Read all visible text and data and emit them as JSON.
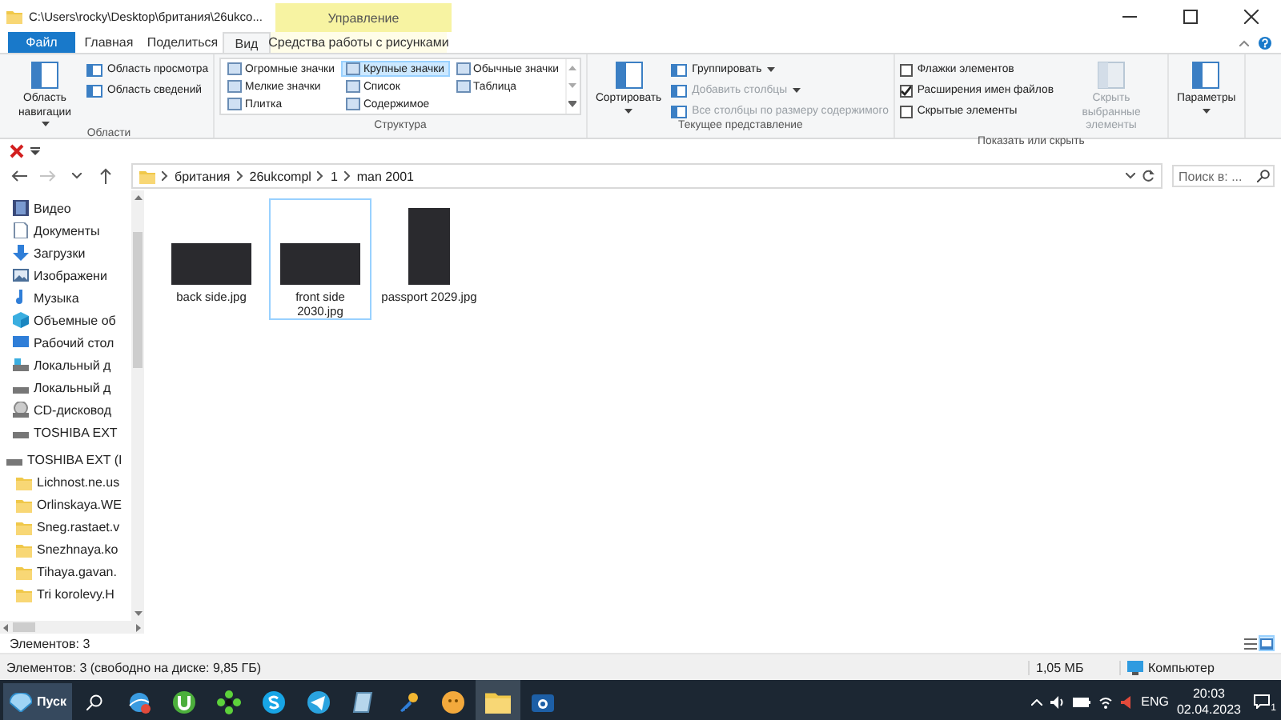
{
  "window": {
    "title": "C:\\Users\\rocky\\Desktop\\британия\\26ukco...",
    "context_header": "Управление"
  },
  "tabs": [
    {
      "label": "Файл",
      "kind": "file",
      "selected": false
    },
    {
      "label": "Главная",
      "kind": "tab",
      "selected": false
    },
    {
      "label": "Поделиться",
      "kind": "tab",
      "selected": false
    },
    {
      "label": "Вид",
      "kind": "tab",
      "selected": true
    },
    {
      "label": "Средства работы с рисунками",
      "kind": "context",
      "selected": false
    }
  ],
  "ribbon": {
    "groups": [
      {
        "label": "Области",
        "items": [
          {
            "kind": "large",
            "label": "Область навигации",
            "dropdown": true,
            "disabled": false
          },
          {
            "kind": "small",
            "label": "Область просмотра",
            "dropdown": false,
            "disabled": false
          },
          {
            "kind": "small",
            "label": "Область сведений",
            "dropdown": false,
            "disabled": false
          }
        ]
      },
      {
        "label": "Структура",
        "items": [
          {
            "kind": "gallery",
            "label": "Огромные значки",
            "selected": false
          },
          {
            "kind": "gallery",
            "label": "Крупные значки",
            "selected": true
          },
          {
            "kind": "gallery",
            "label": "Обычные значки",
            "selected": false
          },
          {
            "kind": "gallery",
            "label": "Мелкие значки",
            "selected": false
          },
          {
            "kind": "gallery",
            "label": "Список",
            "selected": false
          },
          {
            "kind": "gallery",
            "label": "Таблица",
            "selected": false
          },
          {
            "kind": "gallery",
            "label": "Плитка",
            "selected": false
          },
          {
            "kind": "gallery",
            "label": "Содержимое",
            "selected": false
          }
        ]
      },
      {
        "label": "Текущее представление",
        "items": [
          {
            "kind": "large",
            "label": "Сортировать",
            "dropdown": true,
            "disabled": false
          },
          {
            "kind": "small",
            "label": "Группировать",
            "dropdown": true,
            "disabled": false
          },
          {
            "kind": "small",
            "label": "Добавить столбцы",
            "dropdown": true,
            "disabled": true
          },
          {
            "kind": "small",
            "label": "Все столбцы по размеру содержимого",
            "dropdown": false,
            "disabled": true
          }
        ]
      },
      {
        "label": "Показать или скрыть",
        "items": [
          {
            "kind": "checkbox",
            "label": "Флажки элементов",
            "checked": false
          },
          {
            "kind": "checkbox",
            "label": "Расширения имен файлов",
            "checked": true
          },
          {
            "kind": "checkbox",
            "label": "Скрытые элементы",
            "checked": false
          },
          {
            "kind": "large",
            "label": "Скрыть выбранные элементы",
            "dropdown": false,
            "disabled": true
          }
        ]
      },
      {
        "items": [
          {
            "kind": "large",
            "label": "Параметры",
            "dropdown": true,
            "disabled": false
          }
        ]
      }
    ]
  },
  "nav_buttons": [
    {
      "kind": "back",
      "disabled": false
    },
    {
      "kind": "forward",
      "disabled": true
    },
    {
      "kind": "recent",
      "disabled": false
    },
    {
      "kind": "up",
      "disabled": false
    }
  ],
  "address": {
    "crumbs": [
      "британия",
      "26ukcompl",
      "1",
      "man 2001"
    ]
  },
  "search": {
    "placeholder": "Поиск в: ..."
  },
  "sidebar": {
    "items": [
      "Видео",
      "Документы",
      "Загрузки",
      "Изображени",
      "Музыка",
      "Объемные об",
      "Рабочий стол",
      "Локальный д",
      "Локальный д",
      "CD-дисковод",
      "TOSHIBA EXT"
    ],
    "drives": [
      {
        "label": "TOSHIBA EXT (I",
        "children": [
          {
            "label": "Lichnost.ne.us"
          },
          {
            "label": "Orlinskaya.WE"
          },
          {
            "label": "Sneg.rastaet.v"
          },
          {
            "label": "Snezhnaya.ko"
          },
          {
            "label": "Tihaya.gavan."
          },
          {
            "label": "Tri korolevy.H"
          }
        ]
      }
    ]
  },
  "files": [
    {
      "name": "back side.jpg",
      "kind": "landscape",
      "selected": false
    },
    {
      "name": "front side 2030.jpg",
      "kind": "landscape",
      "selected": true
    },
    {
      "name": "passport 2029.jpg",
      "kind": "portrait",
      "selected": false
    }
  ],
  "pane_status": {
    "text": "Элементов: 3",
    "views": [
      {
        "kind": "details",
        "selected": false
      },
      {
        "kind": "icons",
        "selected": true
      }
    ]
  },
  "status_bar": {
    "text": "Элементов: 3 (свободно на диске: 9,85 ГБ)",
    "size": "1,05 МБ",
    "location": "Компьютер"
  },
  "taskbar": {
    "start": "Пуск",
    "apps": [
      {
        "selected": false
      },
      {
        "selected": false
      },
      {
        "selected": false
      },
      {
        "selected": false
      },
      {
        "selected": false
      },
      {
        "selected": false
      },
      {
        "selected": false
      },
      {
        "selected": false
      },
      {
        "selected": true
      },
      {
        "selected": false
      }
    ],
    "language": "ENG",
    "time": "20:03",
    "date": "02.04.2023",
    "notifications": "1"
  }
}
